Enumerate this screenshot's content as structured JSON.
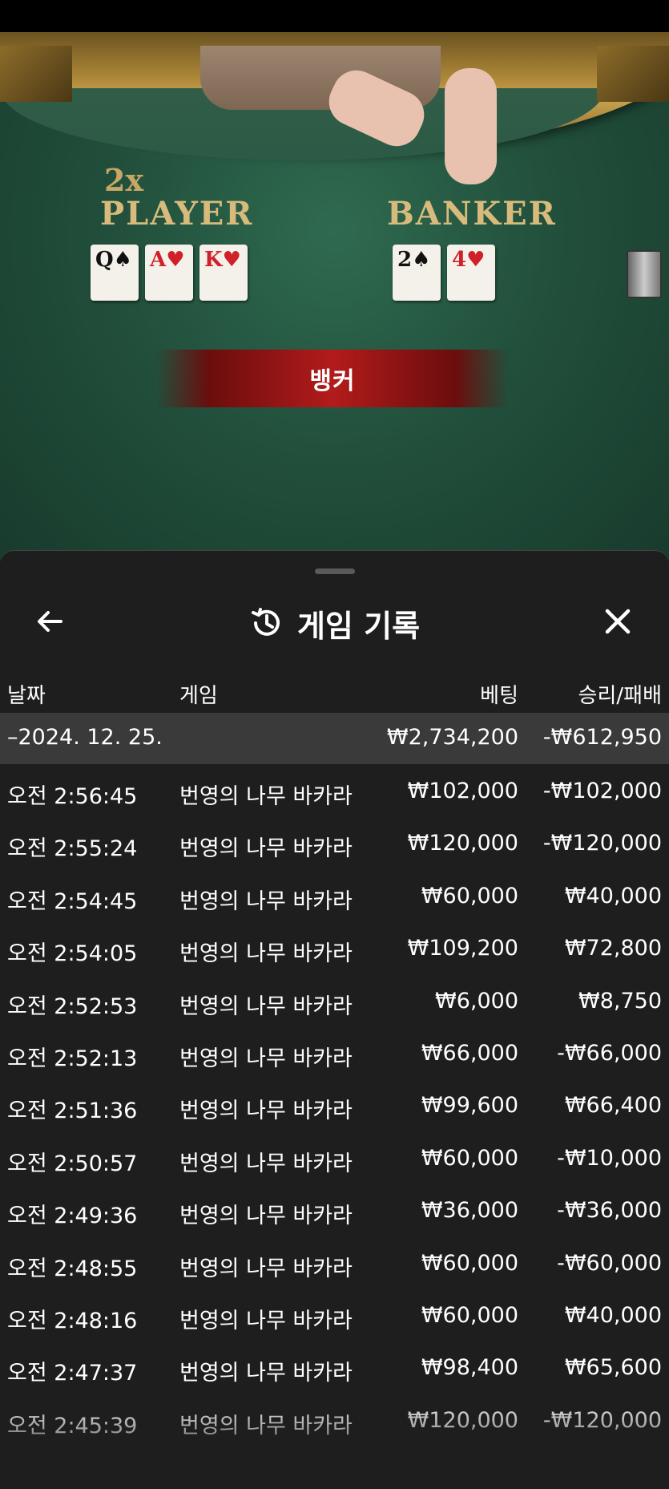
{
  "table": {
    "multiplier": "2x",
    "player_label": "PLAYER",
    "banker_label": "BANKER",
    "player_cards": [
      {
        "rank": "Q",
        "suit": "♠",
        "color": "black"
      },
      {
        "rank": "A",
        "suit": "♥",
        "color": "red"
      },
      {
        "rank": "K",
        "suit": "♥",
        "color": "red"
      }
    ],
    "banker_cards": [
      {
        "rank": "2",
        "suit": "♠",
        "color": "black"
      },
      {
        "rank": "4",
        "suit": "♥",
        "color": "red"
      }
    ],
    "result": "뱅커"
  },
  "sheet": {
    "title": "게임 기록",
    "columns": {
      "date": "날짜",
      "game": "게임",
      "bet": "베팅",
      "result": "승리/패배"
    },
    "summary": {
      "date": "–2024. 12. 25.",
      "bet": "₩2,734,200",
      "result": "-₩612,950"
    },
    "rows": [
      {
        "time": "오전 2:56:45",
        "game": "번영의 나무 바카라",
        "bet": "₩102,000",
        "result": "-₩102,000"
      },
      {
        "time": "오전 2:55:24",
        "game": "번영의 나무 바카라",
        "bet": "₩120,000",
        "result": "-₩120,000"
      },
      {
        "time": "오전 2:54:45",
        "game": "번영의 나무 바카라",
        "bet": "₩60,000",
        "result": "₩40,000"
      },
      {
        "time": "오전 2:54:05",
        "game": "번영의 나무 바카라",
        "bet": "₩109,200",
        "result": "₩72,800"
      },
      {
        "time": "오전 2:52:53",
        "game": "번영의 나무 바카라",
        "bet": "₩6,000",
        "result": "₩8,750"
      },
      {
        "time": "오전 2:52:13",
        "game": "번영의 나무 바카라",
        "bet": "₩66,000",
        "result": "-₩66,000"
      },
      {
        "time": "오전 2:51:36",
        "game": "번영의 나무 바카라",
        "bet": "₩99,600",
        "result": "₩66,400"
      },
      {
        "time": "오전 2:50:57",
        "game": "번영의 나무 바카라",
        "bet": "₩60,000",
        "result": "-₩10,000"
      },
      {
        "time": "오전 2:49:36",
        "game": "번영의 나무 바카라",
        "bet": "₩36,000",
        "result": "-₩36,000"
      },
      {
        "time": "오전 2:48:55",
        "game": "번영의 나무 바카라",
        "bet": "₩60,000",
        "result": "-₩60,000"
      },
      {
        "time": "오전 2:48:16",
        "game": "번영의 나무 바카라",
        "bet": "₩60,000",
        "result": "₩40,000"
      },
      {
        "time": "오전 2:47:37",
        "game": "번영의 나무 바카라",
        "bet": "₩98,400",
        "result": "₩65,600"
      },
      {
        "time": "오전 2:45:39",
        "game": "번영의 나무 바카라",
        "bet": "₩120,000",
        "result": "-₩120,000"
      }
    ]
  }
}
